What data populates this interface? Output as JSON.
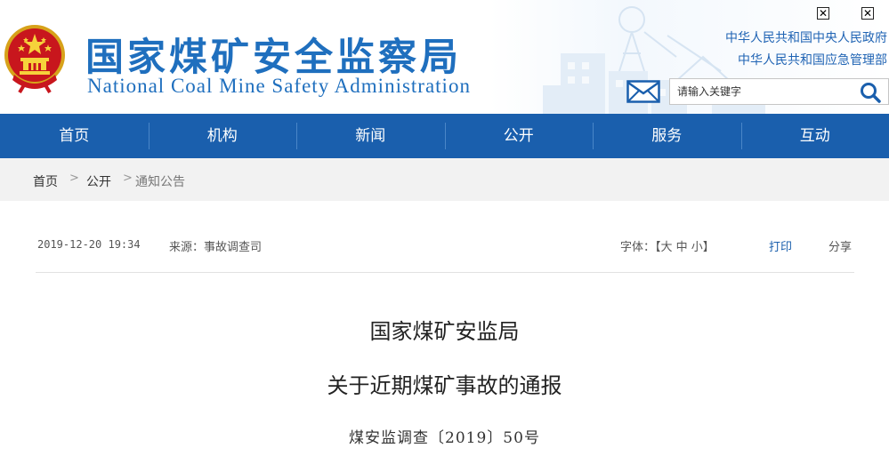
{
  "header": {
    "title_cn": "国家煤矿安全监察局",
    "title_en": "National Coal Mine Safety Administration",
    "close_1": "✕",
    "close_2": "✕",
    "link_1": "中华人民共和国中央人民政府",
    "link_2": "中华人民共和国应急管理部",
    "search_placeholder": "请输入关键字",
    "brand_color": "#1f6fbe"
  },
  "nav": {
    "items": [
      "首页",
      "机构",
      "新闻",
      "公开",
      "服务",
      "互动"
    ],
    "background": "#1a5fad"
  },
  "breadcrumb": {
    "items": [
      "首页",
      "公开",
      "通知公告"
    ],
    "separator": ">"
  },
  "article": {
    "date": "2019-12-20 19:34",
    "source": "来源：事故调查司",
    "font_size_label": "字体：【大 中 小】",
    "print": "打印",
    "share": "分享",
    "title_1": "国家煤矿安监局",
    "title_2": "关于近期煤矿事故的通报",
    "doc_no": "煤安监调查〔2019〕50号"
  },
  "icons": {
    "emblem": "national-emblem-icon",
    "mail": "mail-icon",
    "search": "search-icon",
    "close": "close-icon"
  }
}
